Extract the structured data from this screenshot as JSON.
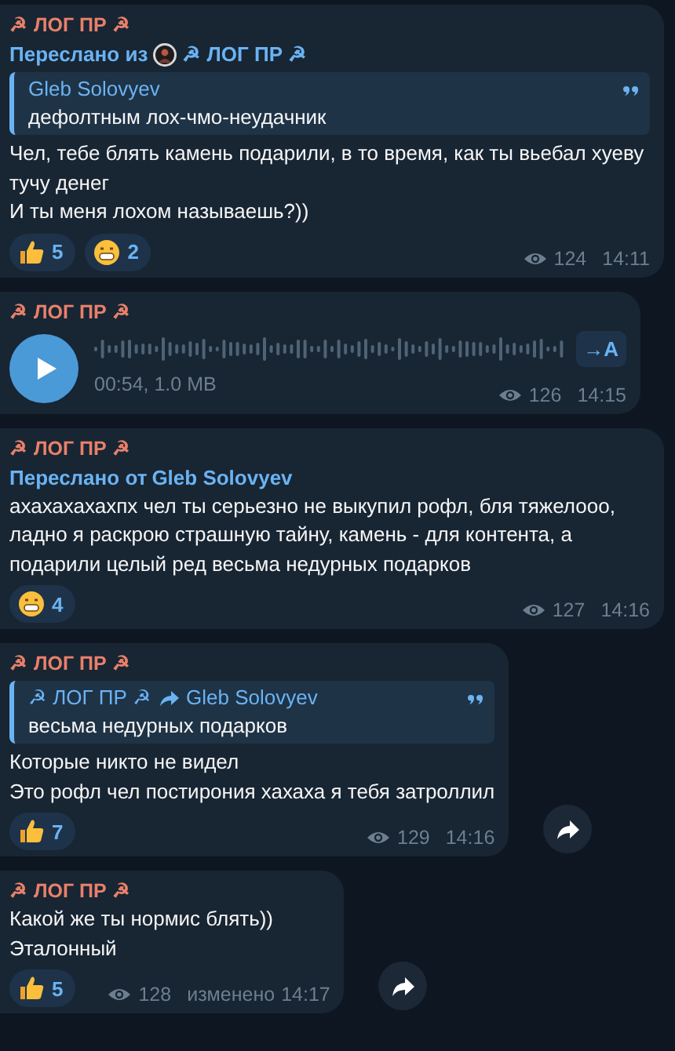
{
  "messages": [
    {
      "kind": "text",
      "sender": "☭ ЛОГ ПР ☭",
      "forward": {
        "prefix": "Переслано из",
        "avatar": true,
        "source": "☭ ЛОГ ПР ☭"
      },
      "quote": {
        "author": "Gleb Solovyev",
        "text": "дефолтным лох-чмо-неудачник"
      },
      "lines": [
        "Чел, тебе блять камень подарили, в то время, как ты вьебал хуеву тучу денег",
        "И ты меня лохом называешь?))"
      ],
      "reactions": [
        {
          "kind": "thumbs_up",
          "count": "5"
        },
        {
          "kind": "grin",
          "count": "2"
        }
      ],
      "views": "124",
      "time": "14:11",
      "share_button": false
    },
    {
      "kind": "voice",
      "sender": "☭ ЛОГ ПР ☭",
      "duration": "00:54, 1.0 MB",
      "transcribe": "→A",
      "views": "126",
      "time": "14:15",
      "share_button": false
    },
    {
      "kind": "text",
      "sender": "☭ ЛОГ ПР ☭",
      "forward": {
        "prefix": "Переслано от",
        "avatar": false,
        "source": "Gleb Solovyev"
      },
      "lines": [
        "ахахахахахпх чел ты серьезно не выкупил рофл, бля тяжелооо, ладно я раскрою страшную тайну, камень - для контента, а подарили целый ред весьма недурных подарков"
      ],
      "reactions": [
        {
          "kind": "grin",
          "count": "4"
        }
      ],
      "views": "127",
      "time": "14:16",
      "share_button": false
    },
    {
      "kind": "text",
      "sender": "☭ ЛОГ ПР ☭",
      "quote": {
        "author": "☭ ЛОГ ПР ☭",
        "via": "Gleb Solovyev",
        "text": "весьма недурных подарков"
      },
      "lines": [
        "Которые никто не видел",
        "Это рофл чел постирония хахаха я тебя затроллил"
      ],
      "reactions": [
        {
          "kind": "thumbs_up",
          "count": "7"
        }
      ],
      "views": "129",
      "time": "14:16",
      "share_button": true
    },
    {
      "kind": "text",
      "sender": "☭ ЛОГ ПР ☭",
      "lines": [
        "Какой же ты нормис блять))",
        "Эталонный"
      ],
      "reactions": [
        {
          "kind": "thumbs_up",
          "count": "5"
        }
      ],
      "views": "128",
      "edited": "изменено",
      "time": "14:17",
      "share_button": true
    }
  ]
}
